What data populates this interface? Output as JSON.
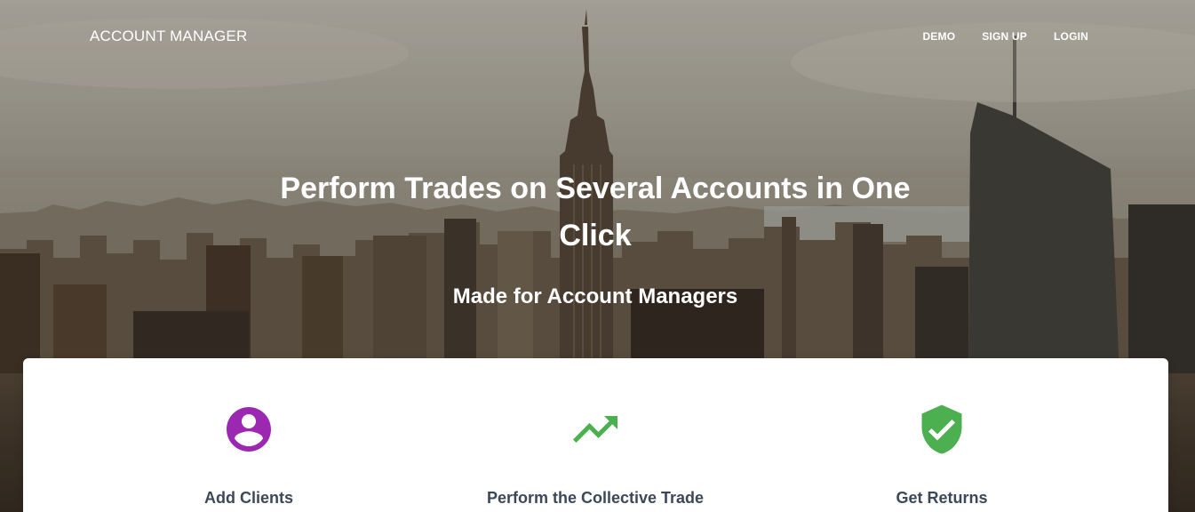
{
  "navbar": {
    "brand": "ACCOUNT MANAGER",
    "links": [
      {
        "label": "DEMO"
      },
      {
        "label": "SIGN UP"
      },
      {
        "label": "LOGIN"
      }
    ]
  },
  "hero": {
    "title": "Perform Trades on Several Accounts in One Click",
    "subtitle": "Made for Account Managers"
  },
  "features": [
    {
      "title": "Add Clients",
      "icon": "account-circle-icon",
      "color": "#9c27b0"
    },
    {
      "title": "Perform the Collective Trade",
      "icon": "trending-up-icon",
      "color": "#4caf50"
    },
    {
      "title": "Get Returns",
      "icon": "verified-shield-icon",
      "color": "#4caf50"
    }
  ],
  "colors": {
    "purple": "#9c27b0",
    "green": "#4caf50",
    "heading": "#3c4858"
  }
}
